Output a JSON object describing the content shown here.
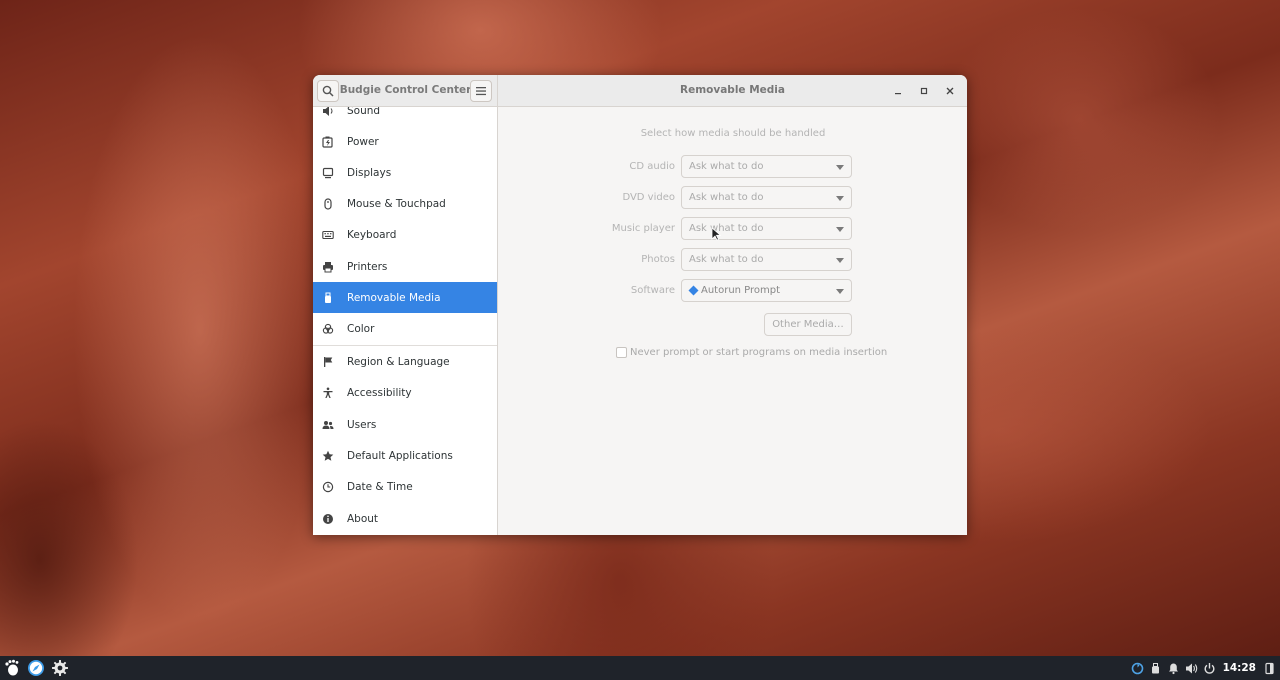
{
  "window": {
    "app_title": "Budgie Control Center",
    "page_title": "Removable Media"
  },
  "sidebar": {
    "items": [
      {
        "label": "Sound",
        "icon": "speaker-icon"
      },
      {
        "label": "Power",
        "icon": "battery-icon"
      },
      {
        "label": "Displays",
        "icon": "display-icon"
      },
      {
        "label": "Mouse & Touchpad",
        "icon": "mouse-icon"
      },
      {
        "label": "Keyboard",
        "icon": "keyboard-icon"
      },
      {
        "label": "Printers",
        "icon": "printer-icon"
      },
      {
        "label": "Removable Media",
        "icon": "usb-drive-icon",
        "selected": true
      },
      {
        "label": "Color",
        "icon": "color-icon"
      },
      {
        "label": "Region & Language",
        "icon": "flag-icon"
      },
      {
        "label": "Accessibility",
        "icon": "accessibility-icon"
      },
      {
        "label": "Users",
        "icon": "users-icon"
      },
      {
        "label": "Default Applications",
        "icon": "star-icon"
      },
      {
        "label": "Date & Time",
        "icon": "clock-icon"
      },
      {
        "label": "About",
        "icon": "info-icon"
      }
    ]
  },
  "content": {
    "heading": "Select how media should be handled",
    "rows": [
      {
        "label": "CD audio",
        "value": "Ask what to do"
      },
      {
        "label": "DVD video",
        "value": "Ask what to do"
      },
      {
        "label": "Music player",
        "value": "Ask what to do"
      },
      {
        "label": "Photos",
        "value": "Ask what to do"
      },
      {
        "label": "Software",
        "value": "Autorun Prompt"
      }
    ],
    "other_media_button": "Other Media…",
    "never_prompt_label": "Never prompt or start programs on media insertion",
    "never_prompt_checked": false
  },
  "panel": {
    "clock": "14:28"
  },
  "colors": {
    "accent": "#3584e4",
    "panel_bg": "#1f232a"
  }
}
